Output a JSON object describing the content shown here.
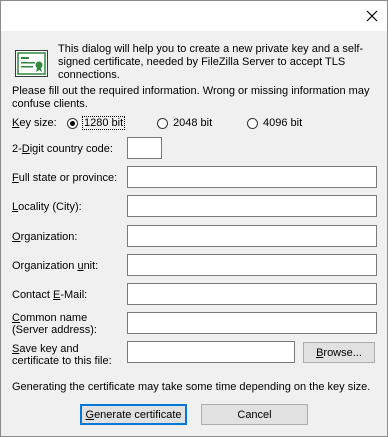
{
  "window": {
    "close_label": "×"
  },
  "intro_text": "This dialog will help you to create a new private key and a self-signed certificate, needed by FileZilla Server to accept TLS connections.",
  "fill_text": "Please fill out the required information. Wrong or missing information may confuse clients.",
  "key_size": {
    "label_mn": "K",
    "label_rest": "ey size:",
    "options": [
      {
        "label": "1280 bit",
        "selected": true
      },
      {
        "label": "2048 bit",
        "selected": false
      },
      {
        "label": "4096 bit",
        "selected": false
      }
    ]
  },
  "fields": {
    "country": {
      "label_pre": "2-",
      "label_mn": "D",
      "label_rest": "igit country code:",
      "value": ""
    },
    "state": {
      "label_pre": "",
      "label_mn": "F",
      "label_rest": "ull state or province:",
      "value": ""
    },
    "locality": {
      "label_pre": "",
      "label_mn": "L",
      "label_rest": "ocality (City):",
      "value": ""
    },
    "organization": {
      "label_pre": "",
      "label_mn": "O",
      "label_rest": "rganization:",
      "value": ""
    },
    "org_unit": {
      "label_pre": "Organization ",
      "label_mn": "u",
      "label_rest": "nit:",
      "value": ""
    },
    "email": {
      "label_pre": "Contact ",
      "label_mn": "E",
      "label_rest": "-Mail:",
      "value": ""
    },
    "common_name": {
      "label_line1_mn": "C",
      "label_line1_rest": "ommon name",
      "label_line2": "(Server address):",
      "value": ""
    },
    "keyfile": {
      "label_line1_mn": "S",
      "label_line1_rest": "ave key and",
      "label_line2": "certificate to this file:",
      "value": ""
    }
  },
  "browse": {
    "pre": "",
    "mn": "B",
    "rest": "rowse..."
  },
  "note": "Generating the certificate may take some time depending on the key size.",
  "buttons": {
    "generate": {
      "mn": "G",
      "rest": "enerate certificate"
    },
    "cancel": "Cancel"
  }
}
